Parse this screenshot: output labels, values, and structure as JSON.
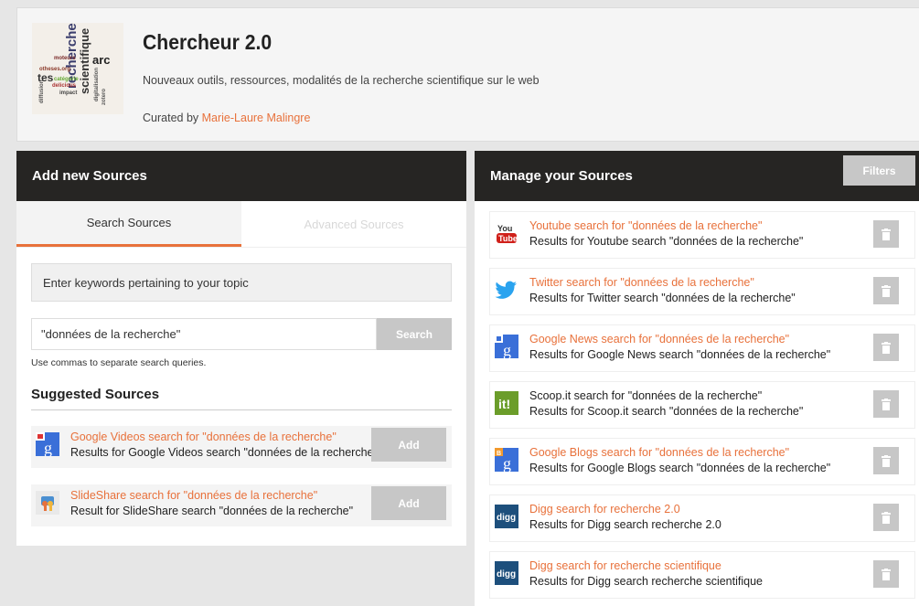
{
  "header": {
    "title": "Chercheur 2.0",
    "subtitle": "Nouveaux outils, ressources, modalités de la recherche scientifique sur le web",
    "curated_prefix": "Curated by ",
    "curator": "Marie-Laure Malingre"
  },
  "add_sources": {
    "heading": "Add new Sources",
    "tabs": [
      "Search Sources",
      "Advanced Sources"
    ],
    "hint": "Enter keywords pertaining to your topic",
    "search_value": "\"données de la recherche\"",
    "search_button": "Search",
    "note": "Use commas to separate search queries.",
    "suggested_title": "Suggested Sources",
    "suggested": [
      {
        "icon": "google-videos-icon",
        "title": "Google Videos search for \"données de la recherche\"",
        "desc": "Results for Google Videos search \"données de la recherche\"",
        "button": "Add"
      },
      {
        "icon": "slideshare-icon",
        "title": "SlideShare search for \"données de la recherche\"",
        "desc": "Result for SlideShare search \"données de la recherche\"",
        "button": "Add"
      }
    ]
  },
  "manage_sources": {
    "heading": "Manage your Sources",
    "filters": "Filters",
    "items": [
      {
        "icon": "youtube-icon",
        "title": "Youtube search for \"données de la recherche\"",
        "desc": "Results for Youtube search \"données de la recherche\""
      },
      {
        "icon": "twitter-icon",
        "title": "Twitter search for \"données de la recherche\"",
        "desc": "Results for Twitter search \"données de la recherche\""
      },
      {
        "icon": "google-news-icon",
        "title": "Google News search for \"données de la recherche\"",
        "desc": "Results for Google News search \"données de la recherche\""
      },
      {
        "icon": "scoopit-icon",
        "title": "Scoop.it search for \"données de la recherche\"",
        "desc": "Results for Scoop.it search \"données de la recherche\""
      },
      {
        "icon": "google-blogs-icon",
        "title": "Google Blogs search for \"données de la recherche\"",
        "desc": "Results for Google Blogs search \"données de la recherche\""
      },
      {
        "icon": "digg-icon",
        "title": "Digg search for recherche 2.0",
        "desc": "Results for Digg search recherche 2.0"
      },
      {
        "icon": "digg-icon",
        "title": "Digg search for recherche scientifique",
        "desc": "Results for Digg search recherche scientifique"
      }
    ]
  },
  "colors": {
    "accent": "#e8713b",
    "dark": "#262523",
    "button": "#c7c7c7"
  }
}
